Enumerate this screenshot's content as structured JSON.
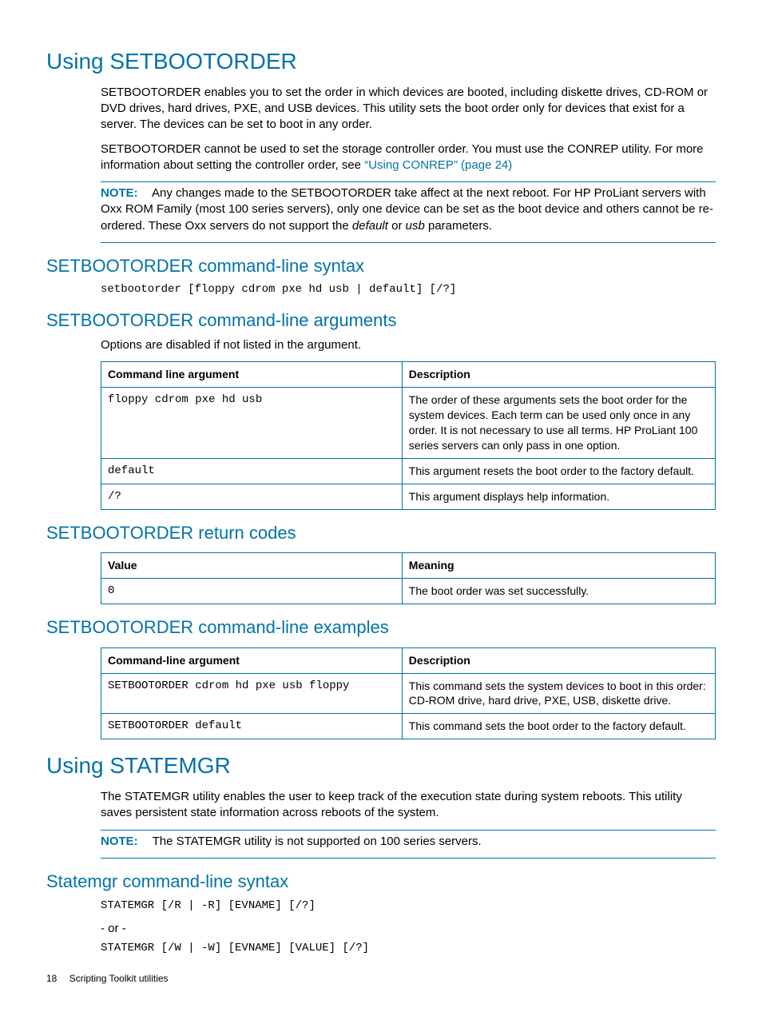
{
  "section1": {
    "title": "Using SETBOOTORDER",
    "para1": "SETBOOTORDER enables you to set the order in which devices are booted, including diskette drives, CD-ROM or DVD drives, hard drives, PXE, and USB devices. This utility sets the boot order only for devices that exist for a server. The devices can be set to boot in any order.",
    "para2_pre": "SETBOOTORDER cannot be used to set the storage controller order. You must use the CONREP utility. For more information about setting the controller order, see ",
    "para2_link": "“Using CONREP” (page 24)",
    "note_label": "NOTE:",
    "note_pre": "Any changes made to the SETBOOTORDER take affect at the next reboot. For HP ProLiant servers with Oxx ROM Family (most 100 series servers), only one device can be set as the boot device and others cannot be re-ordered. These Oxx servers do not support the ",
    "note_em1": "default",
    "note_mid": " or ",
    "note_em2": "usb",
    "note_post": " parameters."
  },
  "syntax1": {
    "title": "SETBOOTORDER command-line syntax",
    "code": "setbootorder [floppy cdrom pxe hd usb | default] [/?]"
  },
  "args": {
    "title": "SETBOOTORDER command-line arguments",
    "intro": "Options are disabled if not listed in the argument.",
    "col1": "Command line argument",
    "col2": "Description",
    "rows": [
      {
        "arg": "floppy cdrom pxe hd usb",
        "desc": "The order of these arguments sets the boot order for the system devices. Each term can be used only once in any order. It is not necessary to use all terms. HP ProLiant 100 series servers can only pass in one option."
      },
      {
        "arg": "default",
        "desc": "This argument resets the boot order to the factory default."
      },
      {
        "arg": "/?",
        "desc": "This argument displays help information."
      }
    ]
  },
  "returns": {
    "title": "SETBOOTORDER return codes",
    "col1": "Value",
    "col2": "Meaning",
    "rows": [
      {
        "val": "0",
        "desc": "The boot order was set successfully."
      }
    ]
  },
  "examples": {
    "title": "SETBOOTORDER command-line examples",
    "col1": "Command-line argument",
    "col2": "Description",
    "rows": [
      {
        "arg": "SETBOOTORDER cdrom hd pxe usb floppy",
        "desc": "This command sets the system devices to boot in this order: CD-ROM drive, hard drive, PXE, USB, diskette drive."
      },
      {
        "arg": "SETBOOTORDER default",
        "desc": "This command sets the boot order to the factory default."
      }
    ]
  },
  "section2": {
    "title": "Using STATEMGR",
    "para": "The STATEMGR utility enables the user to keep track of the execution state during system reboots. This utility saves persistent state information across reboots of the system.",
    "note_label": "NOTE:",
    "note_text": "The STATEMGR utility is not supported on 100 series servers."
  },
  "syntax2": {
    "title": "Statemgr command-line syntax",
    "line1": "STATEMGR [/R | -R] [EVNAME] [/?]",
    "sep": "- or -",
    "line2": "STATEMGR [/W | -W] [EVNAME] [VALUE] [/?]"
  },
  "footer": {
    "page": "18",
    "title": "Scripting Toolkit utilities"
  }
}
